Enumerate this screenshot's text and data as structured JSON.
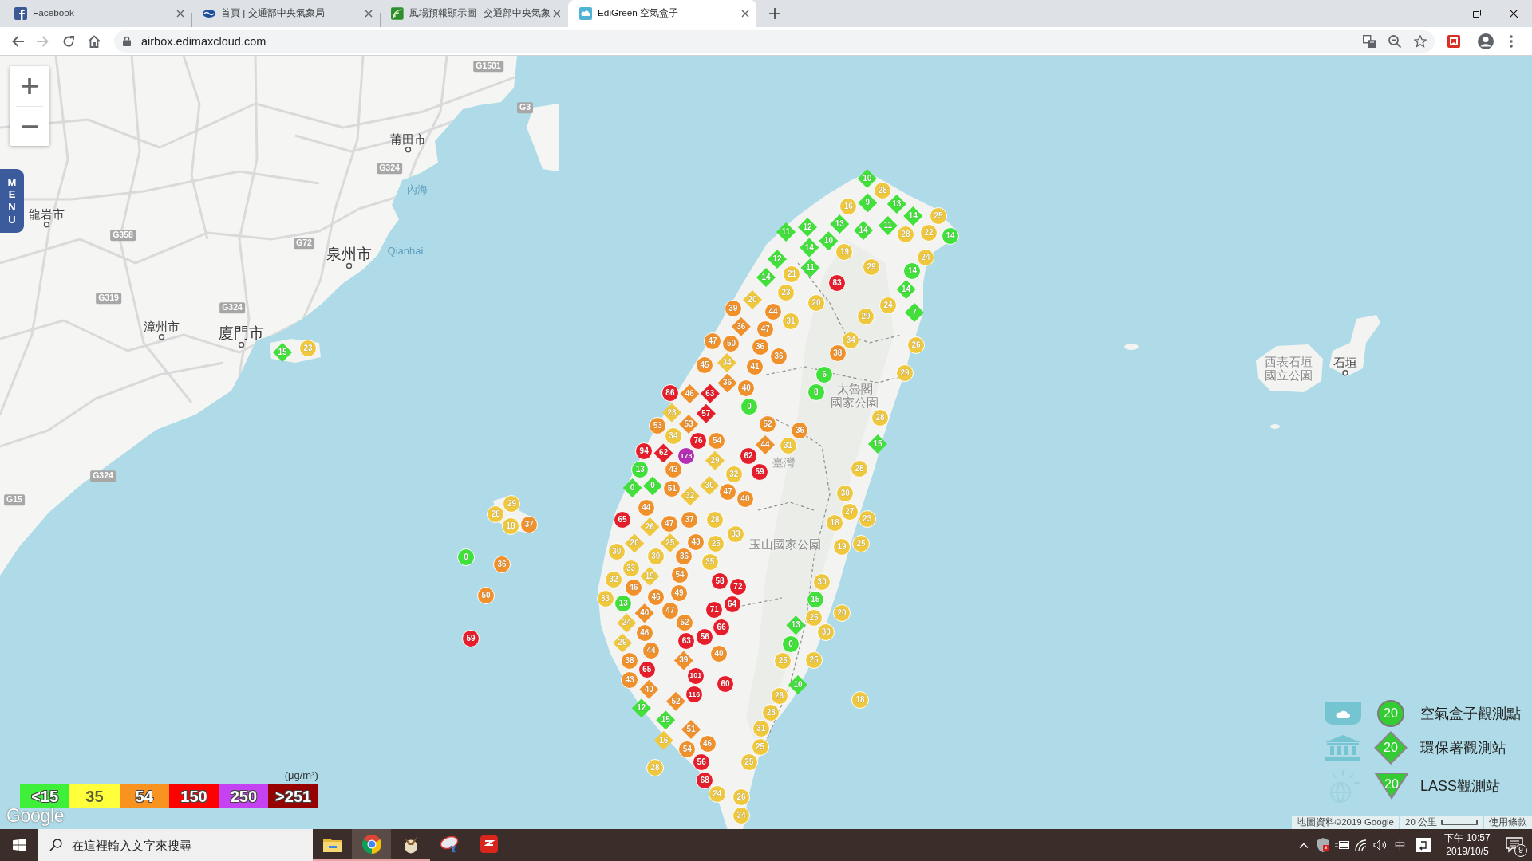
{
  "browser": {
    "tabs": [
      {
        "title": "Facebook",
        "kind": "facebook",
        "selected": false
      },
      {
        "title": "首頁 | 交通部中央氣象局",
        "kind": "weather",
        "selected": false
      },
      {
        "title": "風場預報顯示圖 | 交通部中央氣象",
        "kind": "wind",
        "selected": false
      },
      {
        "title": "EdiGreen 空氣盒子",
        "kind": "airbox",
        "selected": true
      }
    ],
    "address": "airbox.edimaxcloud.com"
  },
  "map": {
    "menu_label": "MENU",
    "places": [
      {
        "name": "G1501",
        "kind": "road"
      },
      {
        "name": "G3",
        "kind": "road"
      },
      {
        "name": "莆田市",
        "kind": "city"
      },
      {
        "name": "龍岩市",
        "kind": "city"
      },
      {
        "name": "G324",
        "kind": "road"
      },
      {
        "name": "內海",
        "kind": "water"
      },
      {
        "name": "G358",
        "kind": "road"
      },
      {
        "name": "G72",
        "kind": "road"
      },
      {
        "name": "泉州市",
        "kind": "major_city"
      },
      {
        "name": "Qianhai",
        "kind": "water"
      },
      {
        "name": "G319",
        "kind": "road"
      },
      {
        "name": "G324",
        "kind": "road"
      },
      {
        "name": "漳州市",
        "kind": "city"
      },
      {
        "name": "廈門市",
        "kind": "major_city"
      },
      {
        "name": "西表石垣國立公園",
        "kind": "park_stacked"
      },
      {
        "name": "石垣",
        "kind": "city"
      },
      {
        "name": "太魯閣國家公園",
        "kind": "park_stacked"
      },
      {
        "name": "臺灣",
        "kind": "region"
      },
      {
        "name": "玉山國家公園",
        "kind": "park"
      },
      {
        "name": "G324",
        "kind": "road"
      },
      {
        "name": "G15",
        "kind": "road"
      }
    ],
    "markers": [
      {
        "value": "10",
        "kind": "diamond",
        "color": "#41e03a"
      },
      {
        "value": "28",
        "kind": "circle",
        "color": "#f0c83e"
      },
      {
        "value": "16",
        "kind": "circle",
        "color": "#f0c83e"
      },
      {
        "value": "9",
        "kind": "diamond",
        "color": "#41e03a"
      },
      {
        "value": "13",
        "kind": "diamond",
        "color": "#41e03a"
      },
      {
        "value": "14",
        "kind": "diamond",
        "color": "#41e03a"
      },
      {
        "value": "25",
        "kind": "circle",
        "color": "#f0c83e"
      },
      {
        "value": "12",
        "kind": "diamond",
        "color": "#41e03a"
      },
      {
        "value": "13",
        "kind": "diamond",
        "color": "#41e03a"
      },
      {
        "value": "14",
        "kind": "diamond",
        "color": "#41e03a"
      },
      {
        "value": "11",
        "kind": "diamond",
        "color": "#41e03a"
      },
      {
        "value": "28",
        "kind": "circle",
        "color": "#f0c83e"
      },
      {
        "value": "22",
        "kind": "circle",
        "color": "#f0c83e"
      },
      {
        "value": "14",
        "kind": "circle",
        "color": "#41e03a"
      },
      {
        "value": "11",
        "kind": "diamond",
        "color": "#41e03a"
      },
      {
        "value": "10",
        "kind": "diamond",
        "color": "#41e03a"
      },
      {
        "value": "14",
        "kind": "diamond",
        "color": "#41e03a"
      },
      {
        "value": "19",
        "kind": "circle",
        "color": "#f0c83e"
      },
      {
        "value": "12",
        "kind": "diamond",
        "color": "#41e03a"
      },
      {
        "value": "11",
        "kind": "diamond",
        "color": "#41e03a"
      },
      {
        "value": "21",
        "kind": "circle",
        "color": "#f0c83e"
      },
      {
        "value": "29",
        "kind": "circle",
        "color": "#f0c83e"
      },
      {
        "value": "24",
        "kind": "circle",
        "color": "#f0c83e"
      },
      {
        "value": "14",
        "kind": "diamond",
        "color": "#41e03a"
      },
      {
        "value": "83",
        "kind": "circle",
        "color": "#e61e2b"
      },
      {
        "value": "14",
        "kind": "circle",
        "color": "#41e03a"
      },
      {
        "value": "14",
        "kind": "diamond",
        "color": "#41e03a"
      },
      {
        "value": "23",
        "kind": "circle",
        "color": "#f0c83e"
      },
      {
        "value": "20",
        "kind": "diamond",
        "color": "#f0c83e"
      },
      {
        "value": "20",
        "kind": "circle",
        "color": "#f0c83e"
      },
      {
        "value": "24",
        "kind": "circle",
        "color": "#f0c83e"
      },
      {
        "value": "7",
        "kind": "diamond",
        "color": "#41e03a"
      },
      {
        "value": "39",
        "kind": "circle",
        "color": "#f0912c"
      },
      {
        "value": "44",
        "kind": "circle",
        "color": "#f0912c"
      },
      {
        "value": "31",
        "kind": "circle",
        "color": "#f0c83e"
      },
      {
        "value": "29",
        "kind": "circle",
        "color": "#f0c83e"
      },
      {
        "value": "36",
        "kind": "diamond",
        "color": "#f0912c"
      },
      {
        "value": "47",
        "kind": "circle",
        "color": "#f0912c"
      },
      {
        "value": "47",
        "kind": "circle",
        "color": "#f0912c"
      },
      {
        "value": "50",
        "kind": "circle",
        "color": "#f0912c"
      },
      {
        "value": "36",
        "kind": "circle",
        "color": "#f0912c"
      },
      {
        "value": "36",
        "kind": "circle",
        "color": "#f0912c"
      },
      {
        "value": "34",
        "kind": "circle",
        "color": "#f0c83e"
      },
      {
        "value": "38",
        "kind": "circle",
        "color": "#f0912c"
      },
      {
        "value": "26",
        "kind": "circle",
        "color": "#f0c83e"
      },
      {
        "value": "45",
        "kind": "circle",
        "color": "#f0912c"
      },
      {
        "value": "34",
        "kind": "diamond",
        "color": "#f0c83e"
      },
      {
        "value": "41",
        "kind": "circle",
        "color": "#f0912c"
      },
      {
        "value": "6",
        "kind": "circle",
        "color": "#41e03a"
      },
      {
        "value": "8",
        "kind": "circle",
        "color": "#41e03a"
      },
      {
        "value": "29",
        "kind": "circle",
        "color": "#f0c83e"
      },
      {
        "value": "36",
        "kind": "diamond",
        "color": "#f0912c"
      },
      {
        "value": "40",
        "kind": "circle",
        "color": "#f0912c"
      },
      {
        "value": "63",
        "kind": "diamond",
        "color": "#e61e2b"
      },
      {
        "value": "57",
        "kind": "diamond",
        "color": "#e61e2b"
      },
      {
        "value": "0",
        "kind": "circle",
        "color": "#41e03a"
      },
      {
        "value": "28",
        "kind": "circle",
        "color": "#f0c83e"
      },
      {
        "value": "52",
        "kind": "circle",
        "color": "#f0912c"
      },
      {
        "value": "36",
        "kind": "circle",
        "color": "#f0912c"
      },
      {
        "value": "76",
        "kind": "circle",
        "color": "#e61e2b"
      },
      {
        "value": "54",
        "kind": "circle",
        "color": "#f0912c"
      },
      {
        "value": "44",
        "kind": "diamond",
        "color": "#f0912c"
      },
      {
        "value": "31",
        "kind": "circle",
        "color": "#f0c83e"
      },
      {
        "value": "15",
        "kind": "diamond",
        "color": "#41e03a"
      },
      {
        "value": "29",
        "kind": "diamond",
        "color": "#f0c83e"
      },
      {
        "value": "62",
        "kind": "circle",
        "color": "#e61e2b"
      },
      {
        "value": "59",
        "kind": "circle",
        "color": "#e61e2b"
      },
      {
        "value": "28",
        "kind": "circle",
        "color": "#f0c83e"
      },
      {
        "value": "32",
        "kind": "circle",
        "color": "#f0c83e"
      },
      {
        "value": "30",
        "kind": "diamond",
        "color": "#f0c83e"
      },
      {
        "value": "86",
        "kind": "circle",
        "color": "#e61e2b"
      },
      {
        "value": "46",
        "kind": "diamond",
        "color": "#f0912c"
      },
      {
        "value": "23",
        "kind": "diamond",
        "color": "#f0c83e"
      },
      {
        "value": "53",
        "kind": "circle",
        "color": "#f0912c"
      },
      {
        "value": "53",
        "kind": "diamond",
        "color": "#f0912c"
      },
      {
        "value": "34",
        "kind": "circle",
        "color": "#f0c83e"
      },
      {
        "value": "94",
        "kind": "circle",
        "color": "#e61e2b"
      },
      {
        "value": "62",
        "kind": "diamond",
        "color": "#e61e2b"
      },
      {
        "value": "173",
        "kind": "circle",
        "color": "#b52fb5"
      },
      {
        "value": "13",
        "kind": "circle",
        "color": "#41e03a"
      },
      {
        "value": "43",
        "kind": "circle",
        "color": "#f0912c"
      },
      {
        "value": "0",
        "kind": "diamond",
        "color": "#41e03a"
      },
      {
        "value": "0",
        "kind": "diamond",
        "color": "#41e03a"
      },
      {
        "value": "51",
        "kind": "circle",
        "color": "#f0912c"
      },
      {
        "value": "32",
        "kind": "diamond",
        "color": "#f0c83e"
      },
      {
        "value": "47",
        "kind": "circle",
        "color": "#f0912c"
      },
      {
        "value": "40",
        "kind": "circle",
        "color": "#f0912c"
      },
      {
        "value": "44",
        "kind": "circle",
        "color": "#f0912c"
      },
      {
        "value": "65",
        "kind": "circle",
        "color": "#e61e2b"
      },
      {
        "value": "26",
        "kind": "diamond",
        "color": "#f0c83e"
      },
      {
        "value": "47",
        "kind": "circle",
        "color": "#f0912c"
      },
      {
        "value": "37",
        "kind": "circle",
        "color": "#f0912c"
      },
      {
        "value": "28",
        "kind": "circle",
        "color": "#f0c83e"
      },
      {
        "value": "33",
        "kind": "circle",
        "color": "#f0c83e"
      },
      {
        "value": "20",
        "kind": "diamond",
        "color": "#f0c83e"
      },
      {
        "value": "25",
        "kind": "diamond",
        "color": "#f0c83e"
      },
      {
        "value": "43",
        "kind": "circle",
        "color": "#f0912c"
      },
      {
        "value": "25",
        "kind": "circle",
        "color": "#f0c83e"
      },
      {
        "value": "30",
        "kind": "circle",
        "color": "#f0c83e"
      },
      {
        "value": "30",
        "kind": "circle",
        "color": "#f0c83e"
      },
      {
        "value": "36",
        "kind": "circle",
        "color": "#f0912c"
      },
      {
        "value": "35",
        "kind": "circle",
        "color": "#f0c83e"
      },
      {
        "value": "33",
        "kind": "circle",
        "color": "#f0c83e"
      },
      {
        "value": "54",
        "kind": "circle",
        "color": "#f0912c"
      },
      {
        "value": "19",
        "kind": "diamond",
        "color": "#f0c83e"
      },
      {
        "value": "32",
        "kind": "circle",
        "color": "#f0c83e"
      },
      {
        "value": "58",
        "kind": "circle",
        "color": "#e61e2b"
      },
      {
        "value": "72",
        "kind": "circle",
        "color": "#e61e2b"
      },
      {
        "value": "46",
        "kind": "circle",
        "color": "#f0912c"
      },
      {
        "value": "49",
        "kind": "circle",
        "color": "#f0912c"
      },
      {
        "value": "33",
        "kind": "circle",
        "color": "#f0c83e"
      },
      {
        "value": "46",
        "kind": "circle",
        "color": "#f0912c"
      },
      {
        "value": "64",
        "kind": "circle",
        "color": "#e61e2b"
      },
      {
        "value": "13",
        "kind": "circle",
        "color": "#41e03a"
      },
      {
        "value": "40",
        "kind": "diamond",
        "color": "#f0912c"
      },
      {
        "value": "47",
        "kind": "circle",
        "color": "#f0912c"
      },
      {
        "value": "71",
        "kind": "circle",
        "color": "#e61e2b"
      },
      {
        "value": "24",
        "kind": "diamond",
        "color": "#f0c83e"
      },
      {
        "value": "52",
        "kind": "circle",
        "color": "#f0912c"
      },
      {
        "value": "66",
        "kind": "circle",
        "color": "#e61e2b"
      },
      {
        "value": "46",
        "kind": "circle",
        "color": "#f0912c"
      },
      {
        "value": "56",
        "kind": "circle",
        "color": "#e61e2b"
      },
      {
        "value": "29",
        "kind": "diamond",
        "color": "#f0c83e"
      },
      {
        "value": "63",
        "kind": "circle",
        "color": "#e61e2b"
      },
      {
        "value": "44",
        "kind": "circle",
        "color": "#f0912c"
      },
      {
        "value": "40",
        "kind": "circle",
        "color": "#f0912c"
      },
      {
        "value": "38",
        "kind": "circle",
        "color": "#f0912c"
      },
      {
        "value": "39",
        "kind": "diamond",
        "color": "#f0912c"
      },
      {
        "value": "101",
        "kind": "circle",
        "color": "#e61e2b"
      },
      {
        "value": "65",
        "kind": "circle",
        "color": "#e61e2b"
      },
      {
        "value": "43",
        "kind": "circle",
        "color": "#f0912c"
      },
      {
        "value": "60",
        "kind": "circle",
        "color": "#e61e2b"
      },
      {
        "value": "40",
        "kind": "diamond",
        "color": "#f0912c"
      },
      {
        "value": "116",
        "kind": "circle",
        "color": "#e61e2b"
      },
      {
        "value": "52",
        "kind": "diamond",
        "color": "#f0912c"
      },
      {
        "value": "12",
        "kind": "diamond",
        "color": "#41e03a"
      },
      {
        "value": "15",
        "kind": "diamond",
        "color": "#41e03a"
      },
      {
        "value": "51",
        "kind": "diamond",
        "color": "#f0912c"
      },
      {
        "value": "16",
        "kind": "diamond",
        "color": "#f0c83e"
      },
      {
        "value": "54",
        "kind": "circle",
        "color": "#f0912c"
      },
      {
        "value": "46",
        "kind": "circle",
        "color": "#f0912c"
      },
      {
        "value": "56",
        "kind": "circle",
        "color": "#e61e2b"
      },
      {
        "value": "68",
        "kind": "circle",
        "color": "#e61e2b"
      },
      {
        "value": "28",
        "kind": "circle",
        "color": "#f0c83e"
      },
      {
        "value": "24",
        "kind": "circle",
        "color": "#f0c83e"
      },
      {
        "value": "26",
        "kind": "circle",
        "color": "#f0c83e"
      },
      {
        "value": "34",
        "kind": "circle",
        "color": "#f0c83e"
      },
      {
        "value": "30",
        "kind": "circle",
        "color": "#f0c83e"
      },
      {
        "value": "27",
        "kind": "circle",
        "color": "#f0c83e"
      },
      {
        "value": "23",
        "kind": "circle",
        "color": "#f0c83e"
      },
      {
        "value": "18",
        "kind": "circle",
        "color": "#f0c83e"
      },
      {
        "value": "19",
        "kind": "circle",
        "color": "#f0c83e"
      },
      {
        "value": "25",
        "kind": "circle",
        "color": "#f0c83e"
      },
      {
        "value": "30",
        "kind": "circle",
        "color": "#f0c83e"
      },
      {
        "value": "15",
        "kind": "circle",
        "color": "#41e03a"
      },
      {
        "value": "20",
        "kind": "circle",
        "color": "#f0c83e"
      },
      {
        "value": "25",
        "kind": "circle",
        "color": "#f0c83e"
      },
      {
        "value": "13",
        "kind": "diamond",
        "color": "#41e03a"
      },
      {
        "value": "30",
        "kind": "circle",
        "color": "#f0c83e"
      },
      {
        "value": "0",
        "kind": "circle",
        "color": "#41e03a"
      },
      {
        "value": "25",
        "kind": "circle",
        "color": "#f0c83e"
      },
      {
        "value": "25",
        "kind": "circle",
        "color": "#f0c83e"
      },
      {
        "value": "10",
        "kind": "diamond",
        "color": "#41e03a"
      },
      {
        "value": "18",
        "kind": "circle",
        "color": "#f0c83e"
      },
      {
        "value": "26",
        "kind": "circle",
        "color": "#f0c83e"
      },
      {
        "value": "28",
        "kind": "circle",
        "color": "#f0c83e"
      },
      {
        "value": "31",
        "kind": "circle",
        "color": "#f0c83e"
      },
      {
        "value": "25",
        "kind": "circle",
        "color": "#f0c83e"
      },
      {
        "value": "25",
        "kind": "circle",
        "color": "#f0c83e"
      },
      {
        "value": "29",
        "kind": "circle",
        "color": "#f0c83e"
      },
      {
        "value": "28",
        "kind": "circle",
        "color": "#f0c83e"
      },
      {
        "value": "18",
        "kind": "circle",
        "color": "#f0c83e"
      },
      {
        "value": "37",
        "kind": "circle",
        "color": "#f0912c"
      },
      {
        "value": "0",
        "kind": "circle",
        "color": "#41e03a"
      },
      {
        "value": "36",
        "kind": "circle",
        "color": "#f0912c"
      },
      {
        "value": "50",
        "kind": "circle",
        "color": "#f0912c"
      },
      {
        "value": "59",
        "kind": "circle",
        "color": "#e61e2b"
      },
      {
        "value": "15",
        "kind": "diamond",
        "color": "#41e03a"
      },
      {
        "value": "23",
        "kind": "circle",
        "color": "#f0c83e"
      }
    ],
    "scale": {
      "unit": "(μg/m³)",
      "steps": [
        {
          "label": "<15",
          "color": "#3ff03a"
        },
        {
          "label": "35",
          "color": "#ffff3c"
        },
        {
          "label": "54",
          "color": "#f7931e"
        },
        {
          "label": "150",
          "color": "#ff0000"
        },
        {
          "label": "250",
          "color": "#c542f2"
        },
        {
          "label": ">251",
          "color": "#960000"
        }
      ]
    },
    "logo": "Google",
    "station_legend": [
      {
        "kind": "circle",
        "value": "20",
        "label": "空氣盒子觀測點"
      },
      {
        "kind": "diamond",
        "value": "20",
        "label": "環保署觀測站"
      },
      {
        "kind": "triangle",
        "value": "20",
        "label": "LASS觀測站"
      }
    ],
    "attribution": {
      "data": "地圖資料©2019 Google",
      "scale": "20 公里",
      "terms": "使用條款"
    }
  },
  "taskbar": {
    "search_placeholder": "在這裡輸入文字來搜尋",
    "apps": [
      {
        "kind": "folder",
        "open": true,
        "selected": false
      },
      {
        "kind": "browser",
        "open": true,
        "selected": true
      },
      {
        "kind": "bird",
        "open": true,
        "selected": false
      },
      {
        "kind": "dish",
        "open": false,
        "selected": false
      },
      {
        "kind": "tile",
        "open": false,
        "selected": false
      }
    ],
    "ime": "中",
    "time": "下午 10:57",
    "date": "2019/10/5",
    "notifications": "9"
  }
}
